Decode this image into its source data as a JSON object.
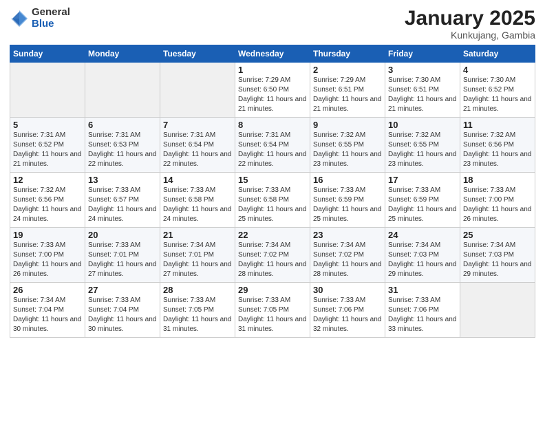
{
  "header": {
    "logo_general": "General",
    "logo_blue": "Blue",
    "title": "January 2025",
    "subtitle": "Kunkujang, Gambia"
  },
  "days_of_week": [
    "Sunday",
    "Monday",
    "Tuesday",
    "Wednesday",
    "Thursday",
    "Friday",
    "Saturday"
  ],
  "weeks": [
    [
      {
        "day": "",
        "info": ""
      },
      {
        "day": "",
        "info": ""
      },
      {
        "day": "",
        "info": ""
      },
      {
        "day": "1",
        "info": "Sunrise: 7:29 AM\nSunset: 6:50 PM\nDaylight: 11 hours and 21 minutes."
      },
      {
        "day": "2",
        "info": "Sunrise: 7:29 AM\nSunset: 6:51 PM\nDaylight: 11 hours and 21 minutes."
      },
      {
        "day": "3",
        "info": "Sunrise: 7:30 AM\nSunset: 6:51 PM\nDaylight: 11 hours and 21 minutes."
      },
      {
        "day": "4",
        "info": "Sunrise: 7:30 AM\nSunset: 6:52 PM\nDaylight: 11 hours and 21 minutes."
      }
    ],
    [
      {
        "day": "5",
        "info": "Sunrise: 7:31 AM\nSunset: 6:52 PM\nDaylight: 11 hours and 21 minutes."
      },
      {
        "day": "6",
        "info": "Sunrise: 7:31 AM\nSunset: 6:53 PM\nDaylight: 11 hours and 22 minutes."
      },
      {
        "day": "7",
        "info": "Sunrise: 7:31 AM\nSunset: 6:54 PM\nDaylight: 11 hours and 22 minutes."
      },
      {
        "day": "8",
        "info": "Sunrise: 7:31 AM\nSunset: 6:54 PM\nDaylight: 11 hours and 22 minutes."
      },
      {
        "day": "9",
        "info": "Sunrise: 7:32 AM\nSunset: 6:55 PM\nDaylight: 11 hours and 23 minutes."
      },
      {
        "day": "10",
        "info": "Sunrise: 7:32 AM\nSunset: 6:55 PM\nDaylight: 11 hours and 23 minutes."
      },
      {
        "day": "11",
        "info": "Sunrise: 7:32 AM\nSunset: 6:56 PM\nDaylight: 11 hours and 23 minutes."
      }
    ],
    [
      {
        "day": "12",
        "info": "Sunrise: 7:32 AM\nSunset: 6:56 PM\nDaylight: 11 hours and 24 minutes."
      },
      {
        "day": "13",
        "info": "Sunrise: 7:33 AM\nSunset: 6:57 PM\nDaylight: 11 hours and 24 minutes."
      },
      {
        "day": "14",
        "info": "Sunrise: 7:33 AM\nSunset: 6:58 PM\nDaylight: 11 hours and 24 minutes."
      },
      {
        "day": "15",
        "info": "Sunrise: 7:33 AM\nSunset: 6:58 PM\nDaylight: 11 hours and 25 minutes."
      },
      {
        "day": "16",
        "info": "Sunrise: 7:33 AM\nSunset: 6:59 PM\nDaylight: 11 hours and 25 minutes."
      },
      {
        "day": "17",
        "info": "Sunrise: 7:33 AM\nSunset: 6:59 PM\nDaylight: 11 hours and 25 minutes."
      },
      {
        "day": "18",
        "info": "Sunrise: 7:33 AM\nSunset: 7:00 PM\nDaylight: 11 hours and 26 minutes."
      }
    ],
    [
      {
        "day": "19",
        "info": "Sunrise: 7:33 AM\nSunset: 7:00 PM\nDaylight: 11 hours and 26 minutes."
      },
      {
        "day": "20",
        "info": "Sunrise: 7:33 AM\nSunset: 7:01 PM\nDaylight: 11 hours and 27 minutes."
      },
      {
        "day": "21",
        "info": "Sunrise: 7:34 AM\nSunset: 7:01 PM\nDaylight: 11 hours and 27 minutes."
      },
      {
        "day": "22",
        "info": "Sunrise: 7:34 AM\nSunset: 7:02 PM\nDaylight: 11 hours and 28 minutes."
      },
      {
        "day": "23",
        "info": "Sunrise: 7:34 AM\nSunset: 7:02 PM\nDaylight: 11 hours and 28 minutes."
      },
      {
        "day": "24",
        "info": "Sunrise: 7:34 AM\nSunset: 7:03 PM\nDaylight: 11 hours and 29 minutes."
      },
      {
        "day": "25",
        "info": "Sunrise: 7:34 AM\nSunset: 7:03 PM\nDaylight: 11 hours and 29 minutes."
      }
    ],
    [
      {
        "day": "26",
        "info": "Sunrise: 7:34 AM\nSunset: 7:04 PM\nDaylight: 11 hours and 30 minutes."
      },
      {
        "day": "27",
        "info": "Sunrise: 7:33 AM\nSunset: 7:04 PM\nDaylight: 11 hours and 30 minutes."
      },
      {
        "day": "28",
        "info": "Sunrise: 7:33 AM\nSunset: 7:05 PM\nDaylight: 11 hours and 31 minutes."
      },
      {
        "day": "29",
        "info": "Sunrise: 7:33 AM\nSunset: 7:05 PM\nDaylight: 11 hours and 31 minutes."
      },
      {
        "day": "30",
        "info": "Sunrise: 7:33 AM\nSunset: 7:06 PM\nDaylight: 11 hours and 32 minutes."
      },
      {
        "day": "31",
        "info": "Sunrise: 7:33 AM\nSunset: 7:06 PM\nDaylight: 11 hours and 33 minutes."
      },
      {
        "day": "",
        "info": ""
      }
    ]
  ]
}
